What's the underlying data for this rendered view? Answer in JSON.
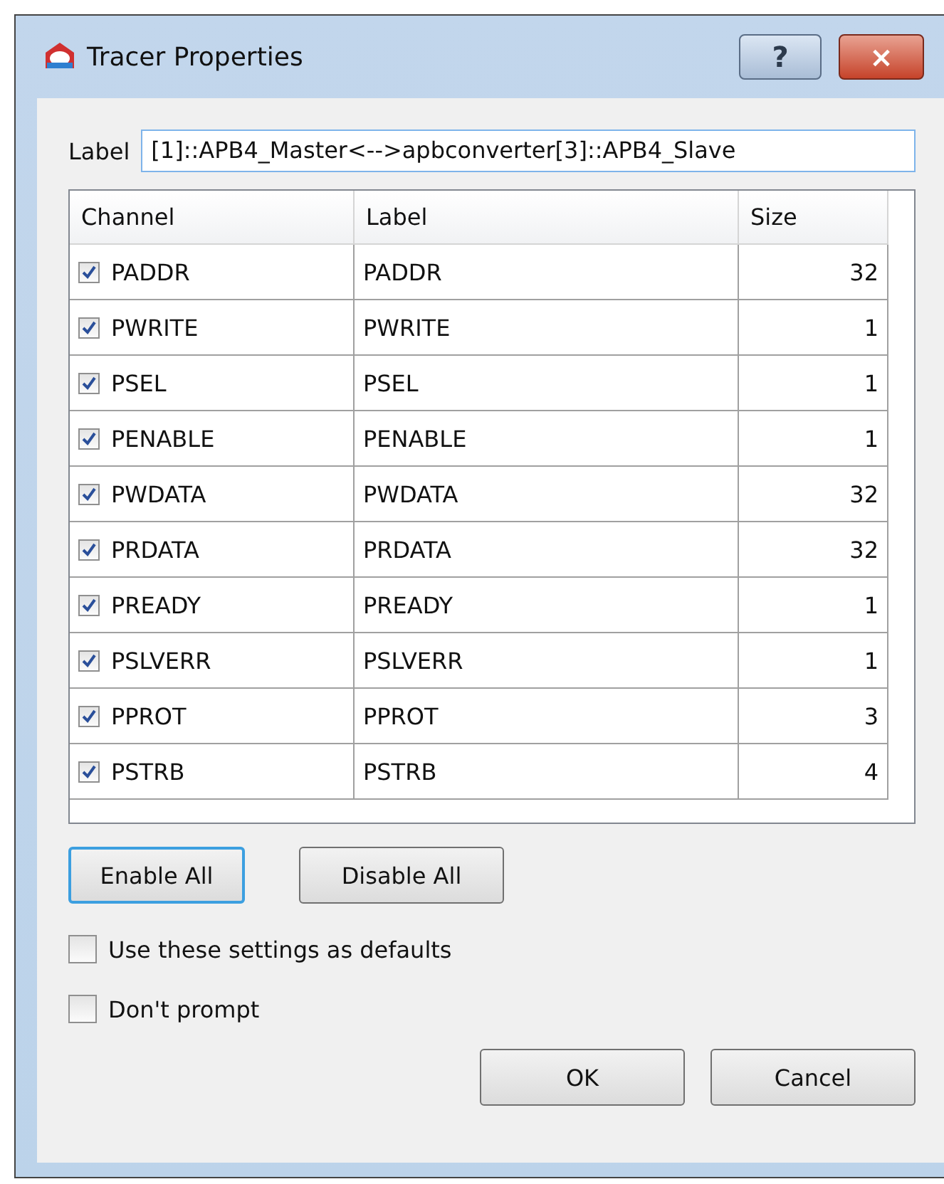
{
  "window": {
    "title": "Tracer Properties",
    "help_button": "?",
    "close_button": "×"
  },
  "label_field": {
    "label": "Label",
    "value": "[1]::APB4_Master<-->apbconverter[3]::APB4_Slave"
  },
  "table": {
    "columns": [
      "Channel",
      "Label",
      "Size"
    ],
    "rows": [
      {
        "channel": "PADDR",
        "label": "PADDR",
        "size": "32",
        "checked": true
      },
      {
        "channel": "PWRITE",
        "label": "PWRITE",
        "size": "1",
        "checked": true
      },
      {
        "channel": "PSEL",
        "label": "PSEL",
        "size": "1",
        "checked": true
      },
      {
        "channel": "PENABLE",
        "label": "PENABLE",
        "size": "1",
        "checked": true
      },
      {
        "channel": "PWDATA",
        "label": "PWDATA",
        "size": "32",
        "checked": true
      },
      {
        "channel": "PRDATA",
        "label": "PRDATA",
        "size": "32",
        "checked": true
      },
      {
        "channel": "PREADY",
        "label": "PREADY",
        "size": "1",
        "checked": true
      },
      {
        "channel": "PSLVERR",
        "label": "PSLVERR",
        "size": "1",
        "checked": true
      },
      {
        "channel": "PPROT",
        "label": "PPROT",
        "size": "3",
        "checked": true
      },
      {
        "channel": "PSTRB",
        "label": "PSTRB",
        "size": "4",
        "checked": true
      }
    ]
  },
  "action_buttons": [
    {
      "label": "Enable All",
      "focused": true
    },
    {
      "label": "Disable All",
      "focused": false
    }
  ],
  "options": [
    {
      "label": "Use these settings as defaults",
      "checked": false
    },
    {
      "label": "Don't prompt",
      "checked": false
    }
  ],
  "dialog_buttons": [
    "OK",
    "Cancel"
  ]
}
